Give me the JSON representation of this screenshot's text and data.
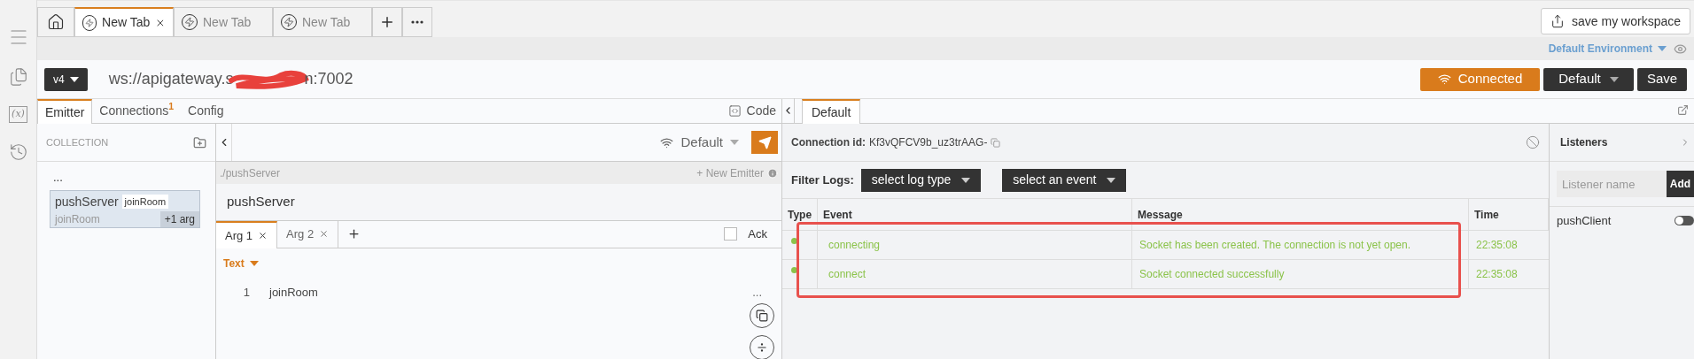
{
  "sidebar": {
    "variables_icon": "(x)"
  },
  "tabs": [
    {
      "label": "New Tab",
      "selected": true
    },
    {
      "label": "New Tab",
      "selected": false
    },
    {
      "label": "New Tab",
      "selected": false
    }
  ],
  "workspace_button": "save my workspace",
  "environment": "Default Environment",
  "url_bar": {
    "version": "v4",
    "url_start": "ws://apigateway.s",
    "url_end": "n:7002",
    "status": "Connected",
    "profile": "Default",
    "save": "Save"
  },
  "left_tabs": [
    {
      "label": "Emitter",
      "selected": true
    },
    {
      "label": "Connections",
      "selected": false,
      "badge": "1"
    },
    {
      "label": "Config",
      "selected": false
    }
  ],
  "code_button": "Code",
  "collection": {
    "title": "COLLECTION",
    "parent": "...",
    "items": [
      {
        "name": "pushServer",
        "tag": "joinRoom",
        "sub": "joinRoom",
        "extra": "+1 arg",
        "selected": true
      }
    ]
  },
  "emitter": {
    "connection": "Default",
    "path": "./pushServer",
    "new_emitter": "+ New Emitter",
    "name": "pushServer",
    "args": [
      {
        "label": "Arg 1",
        "selected": true
      },
      {
        "label": "Arg 2",
        "selected": false
      }
    ],
    "ack": {
      "label": "Ack",
      "checked": false
    },
    "format": "Text",
    "lines": [
      {
        "number": "1",
        "text": "joinRoom"
      }
    ],
    "more": "..."
  },
  "log": {
    "tab": "Default",
    "connection_label": "Connection id:",
    "connection_id": "Kf3vQFCV9b_uz3trAAG-",
    "filter_label": "Filter Logs:",
    "filters": [
      "select log type",
      "select an event"
    ],
    "columns": [
      "Type",
      "Event",
      "Message",
      "Time"
    ],
    "rows": [
      {
        "color": "#8bc34a",
        "event": "connecting",
        "message": "Socket has been created. The connection is not yet open.",
        "time": "22:35:08"
      },
      {
        "color": "#8bc34a",
        "event": "connect",
        "message": "Socket connected successfully",
        "time": "22:35:08"
      }
    ]
  },
  "listeners": {
    "title": "Listeners",
    "placeholder": "Listener name",
    "add": "Add",
    "items": [
      {
        "name": "pushClient",
        "on": false
      }
    ]
  }
}
